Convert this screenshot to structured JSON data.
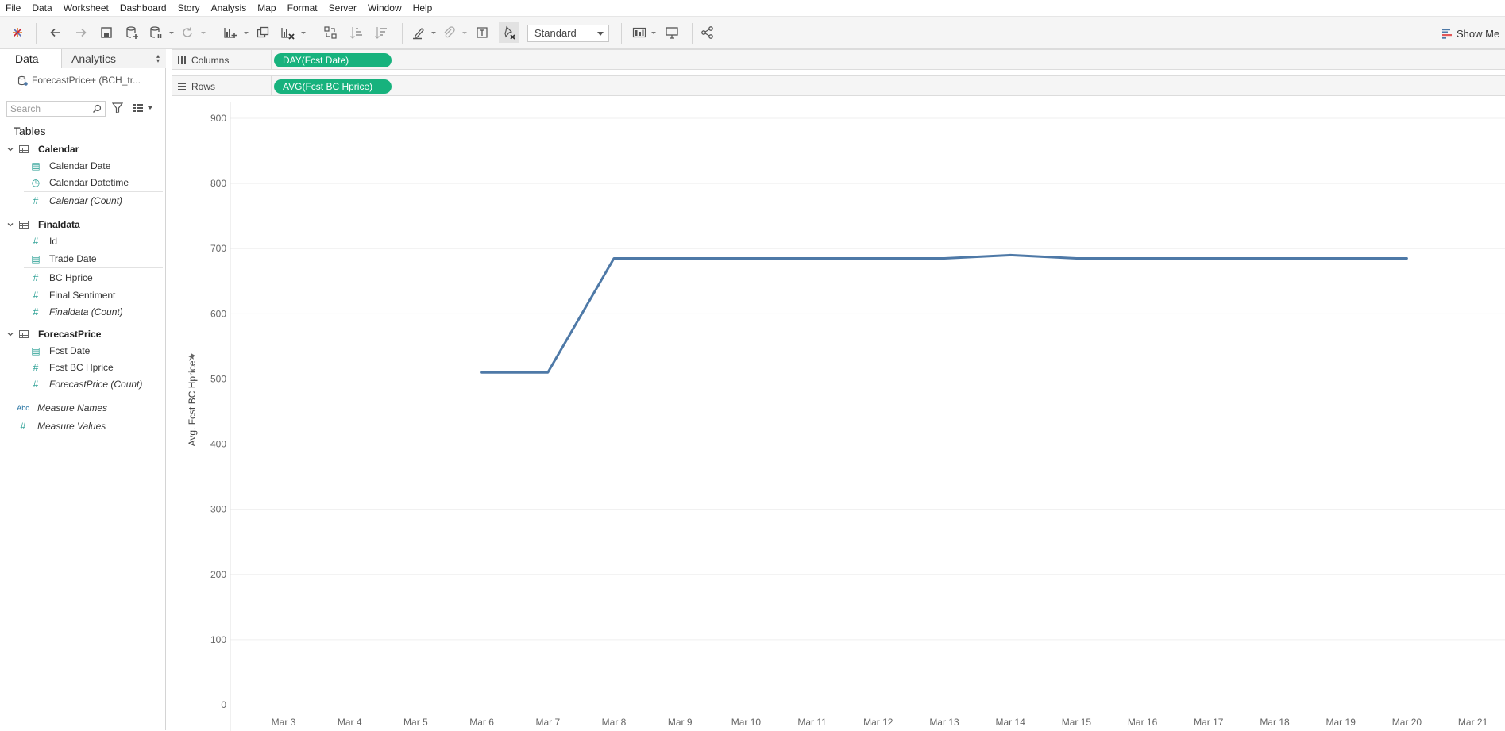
{
  "menu": [
    "File",
    "Data",
    "Worksheet",
    "Dashboard",
    "Story",
    "Analysis",
    "Map",
    "Format",
    "Server",
    "Window",
    "Help"
  ],
  "toolbar": {
    "fit_select_value": "Standard",
    "show_me_label": "Show Me",
    "icons": [
      "tableau-logo-icon",
      "undo-icon",
      "redo-icon",
      "save-icon",
      "new-datasource-icon",
      "pause-updates-icon",
      "refresh-icon",
      "new-worksheet-icon",
      "duplicate-icon",
      "clear-sheet-icon",
      "swap-icon",
      "sort-ascending-icon",
      "sort-descending-icon",
      "highlight-icon",
      "group-members-icon",
      "show-mark-labels-icon",
      "fix-axes-icon",
      "show-cards-icon",
      "presentation-mode-icon",
      "share-icon",
      "show-me-icon"
    ]
  },
  "left_pane": {
    "tabs": {
      "data": "Data",
      "analytics": "Analytics"
    },
    "datasource": "ForecastPrice+ (BCH_tr...",
    "search_placeholder": "Search",
    "tables_heading": "Tables",
    "groups": [
      {
        "name": "Calendar",
        "fields": [
          {
            "name": "Calendar Date",
            "type": "date"
          },
          {
            "name": "Calendar Datetime",
            "type": "datetime"
          },
          {
            "name": "Calendar (Count)",
            "type": "measure-count"
          }
        ]
      },
      {
        "name": "Finaldata",
        "fields": [
          {
            "name": "Id",
            "type": "measure"
          },
          {
            "name": "Trade Date",
            "type": "date"
          },
          {
            "name": "BC Hprice",
            "type": "measure"
          },
          {
            "name": "Final Sentiment",
            "type": "measure"
          },
          {
            "name": "Finaldata (Count)",
            "type": "measure-count"
          }
        ]
      },
      {
        "name": "ForecastPrice",
        "fields": [
          {
            "name": "Fcst Date",
            "type": "date"
          },
          {
            "name": "Fcst BC Hprice",
            "type": "measure"
          },
          {
            "name": "ForecastPrice (Count)",
            "type": "measure-count"
          }
        ]
      }
    ],
    "measure_names": {
      "icon_text": "Abc",
      "label": "Measure Names"
    },
    "measure_values": {
      "label": "Measure Values"
    }
  },
  "shelves": {
    "columns": {
      "label": "Columns",
      "pill": "DAY(Fcst Date)"
    },
    "rows": {
      "label": "Rows",
      "pill": "AVG(Fcst BC Hprice)"
    }
  },
  "colors": {
    "accent_pill": "#17b27d",
    "line": "#4e79a7"
  },
  "chart_data": {
    "type": "line",
    "ylabel": "Avg. Fcst BC Hprice",
    "xlabel": "",
    "ylim": [
      0,
      900
    ],
    "yticks": [
      0,
      100,
      200,
      300,
      400,
      500,
      600,
      700,
      800,
      900
    ],
    "categories": [
      "Mar 3",
      "Mar 4",
      "Mar 5",
      "Mar 6",
      "Mar 7",
      "Mar 8",
      "Mar 9",
      "Mar 10",
      "Mar 11",
      "Mar 12",
      "Mar 13",
      "Mar 14",
      "Mar 15",
      "Mar 16",
      "Mar 17",
      "Mar 18",
      "Mar 19",
      "Mar 20",
      "Mar 21"
    ],
    "grid": true,
    "series": [
      {
        "x": [
          "Mar 6",
          "Mar 7",
          "Mar 8",
          "Mar 9",
          "Mar 10",
          "Mar 11",
          "Mar 12",
          "Mar 13",
          "Mar 14",
          "Mar 15",
          "Mar 16",
          "Mar 17",
          "Mar 18",
          "Mar 19",
          "Mar 20"
        ],
        "values": [
          510,
          510,
          685,
          685,
          685,
          685,
          685,
          685,
          690,
          685,
          685,
          685,
          685,
          685,
          685
        ]
      }
    ]
  }
}
